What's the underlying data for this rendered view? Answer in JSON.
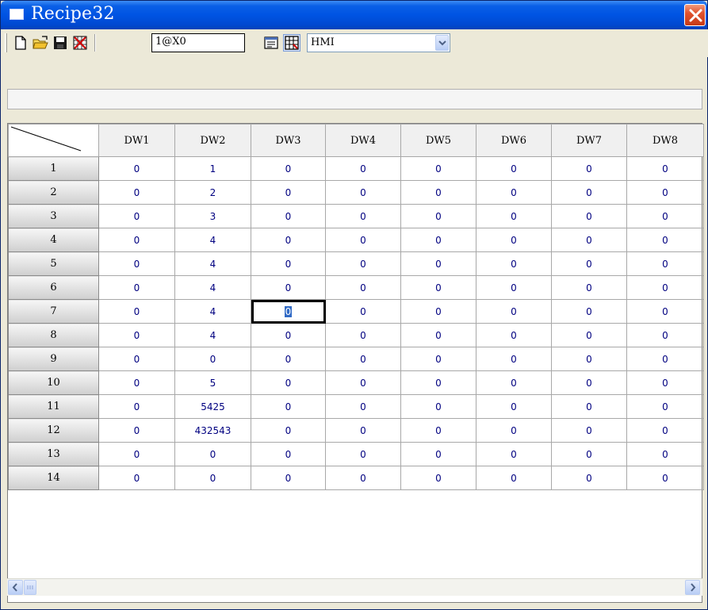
{
  "window": {
    "title": "Recipe32"
  },
  "toolbar": {
    "address_value": "1@X0",
    "device_selected": "HMI",
    "buttons": [
      "new-icon",
      "open-icon",
      "save-icon",
      "delete-icon",
      "properties-icon",
      "grid-icon"
    ]
  },
  "status": {
    "text": ""
  },
  "grid": {
    "columns": [
      "DW1",
      "DW2",
      "DW3",
      "DW4",
      "DW5",
      "DW6",
      "DW7",
      "DW8"
    ],
    "rows": [
      {
        "label": "1",
        "cells": [
          "0",
          "1",
          "0",
          "0",
          "0",
          "0",
          "0",
          "0"
        ]
      },
      {
        "label": "2",
        "cells": [
          "0",
          "2",
          "0",
          "0",
          "0",
          "0",
          "0",
          "0"
        ]
      },
      {
        "label": "3",
        "cells": [
          "0",
          "3",
          "0",
          "0",
          "0",
          "0",
          "0",
          "0"
        ]
      },
      {
        "label": "4",
        "cells": [
          "0",
          "4",
          "0",
          "0",
          "0",
          "0",
          "0",
          "0"
        ]
      },
      {
        "label": "5",
        "cells": [
          "0",
          "4",
          "0",
          "0",
          "0",
          "0",
          "0",
          "0"
        ]
      },
      {
        "label": "6",
        "cells": [
          "0",
          "4",
          "0",
          "0",
          "0",
          "0",
          "0",
          "0"
        ]
      },
      {
        "label": "7",
        "cells": [
          "0",
          "4",
          "0",
          "0",
          "0",
          "0",
          "0",
          "0"
        ]
      },
      {
        "label": "8",
        "cells": [
          "0",
          "4",
          "0",
          "0",
          "0",
          "0",
          "0",
          "0"
        ]
      },
      {
        "label": "9",
        "cells": [
          "0",
          "0",
          "0",
          "0",
          "0",
          "0",
          "0",
          "0"
        ]
      },
      {
        "label": "10",
        "cells": [
          "0",
          "5",
          "0",
          "0",
          "0",
          "0",
          "0",
          "0"
        ]
      },
      {
        "label": "11",
        "cells": [
          "0",
          "5425",
          "0",
          "0",
          "0",
          "0",
          "0",
          "0"
        ]
      },
      {
        "label": "12",
        "cells": [
          "0",
          "432543",
          "0",
          "0",
          "0",
          "0",
          "0",
          "0"
        ]
      },
      {
        "label": "13",
        "cells": [
          "0",
          "0",
          "0",
          "0",
          "0",
          "0",
          "0",
          "0"
        ]
      },
      {
        "label": "14",
        "cells": [
          "0",
          "0",
          "0",
          "0",
          "0",
          "0",
          "0",
          "0"
        ]
      }
    ],
    "selected": {
      "row": 7,
      "column": "DW3"
    }
  }
}
